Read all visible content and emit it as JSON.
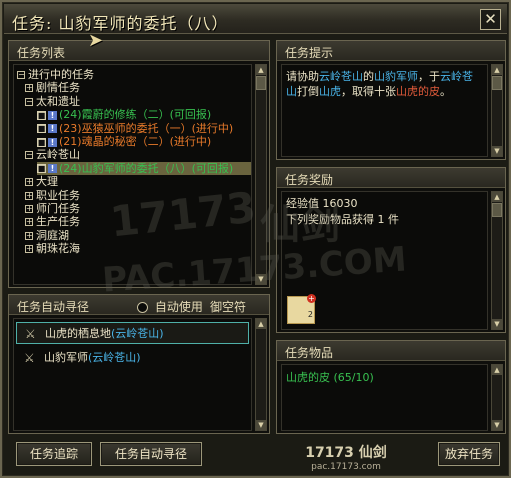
{
  "window": {
    "title": "任务: 山豹军师的委托（八）",
    "close_label": "✕"
  },
  "quest_list": {
    "header": "任务列表",
    "tree": [
      {
        "level": 0,
        "toggle": "−",
        "label": "进行中的任务",
        "color": "white"
      },
      {
        "level": 1,
        "toggle": "+",
        "label": "剧情任务",
        "color": "white"
      },
      {
        "level": 1,
        "toggle": "−",
        "label": "太和遗址",
        "color": "white"
      },
      {
        "level": 2,
        "label": "(24)霞蔚的修练（二）(可回报)",
        "color": "green"
      },
      {
        "level": 2,
        "label": "(23)巫猿巫师的委托（一）(进行中)",
        "color": "orange"
      },
      {
        "level": 2,
        "label": "(21)魂晶的秘密（二）(进行中)",
        "color": "orange"
      },
      {
        "level": 1,
        "toggle": "−",
        "label": "云岭苍山",
        "color": "white"
      },
      {
        "level": 2,
        "label": "(24)山豹军师的委托（八）(可回报)",
        "color": "green",
        "selected": true
      },
      {
        "level": 1,
        "toggle": "+",
        "label": "大理",
        "color": "white"
      },
      {
        "level": 1,
        "toggle": "+",
        "label": "职业任务",
        "color": "white"
      },
      {
        "level": 1,
        "toggle": "+",
        "label": "师门任务",
        "color": "white"
      },
      {
        "level": 1,
        "toggle": "+",
        "label": "生产任务",
        "color": "white"
      },
      {
        "level": 1,
        "toggle": "+",
        "label": "洞庭湖",
        "color": "white"
      },
      {
        "level": 1,
        "toggle": "+",
        "label": "朝珠花海",
        "color": "white"
      }
    ]
  },
  "quest_hint": {
    "header": "任务提示",
    "segments": [
      {
        "text": "请协助",
        "color": "white"
      },
      {
        "text": "云岭苍山",
        "color": "cyan"
      },
      {
        "text": "的",
        "color": "white"
      },
      {
        "text": "山豹军师",
        "color": "cyan"
      },
      {
        "text": "，于",
        "color": "white"
      },
      {
        "text": "云岭苍山",
        "color": "cyan"
      },
      {
        "text": "打倒",
        "color": "white"
      },
      {
        "text": "山虎",
        "color": "cyan"
      },
      {
        "text": "，取得十张",
        "color": "white"
      },
      {
        "text": "山虎的皮",
        "color": "red"
      },
      {
        "text": "。",
        "color": "white"
      }
    ]
  },
  "quest_reward": {
    "header": "任务奖励",
    "exp_line": "经验值 16030",
    "items_line": "下列奖励物品获得 1 件",
    "item_count": "2"
  },
  "auto_path": {
    "header": "任务自动寻径",
    "auto_use_label": "自动使用",
    "item_label": "御空符",
    "rows": [
      {
        "place": "山虎的栖息地",
        "region": "(云岭苍山)",
        "active": true
      },
      {
        "place": "山豹军师",
        "region": "(云岭苍山)",
        "active": false
      }
    ]
  },
  "quest_items": {
    "header": "任务物品",
    "item_name": "山虎的皮",
    "item_progress": "(65/10)"
  },
  "buttons": {
    "track": "任务追踪",
    "auto_path": "任务自动寻径",
    "abandon": "放弃任务"
  },
  "watermark": {
    "logo_text": "17173",
    "site_text": "PAC.17173.COM",
    "brand_text": "仙剑",
    "footer_logo": "17173 仙剑",
    "footer_site": "pac.17173.com"
  },
  "colors": {
    "green": "#38c050",
    "orange": "#e87a2a",
    "cyan": "#4ab4e8",
    "red": "#e05a3a",
    "white": "#ece4c8"
  }
}
